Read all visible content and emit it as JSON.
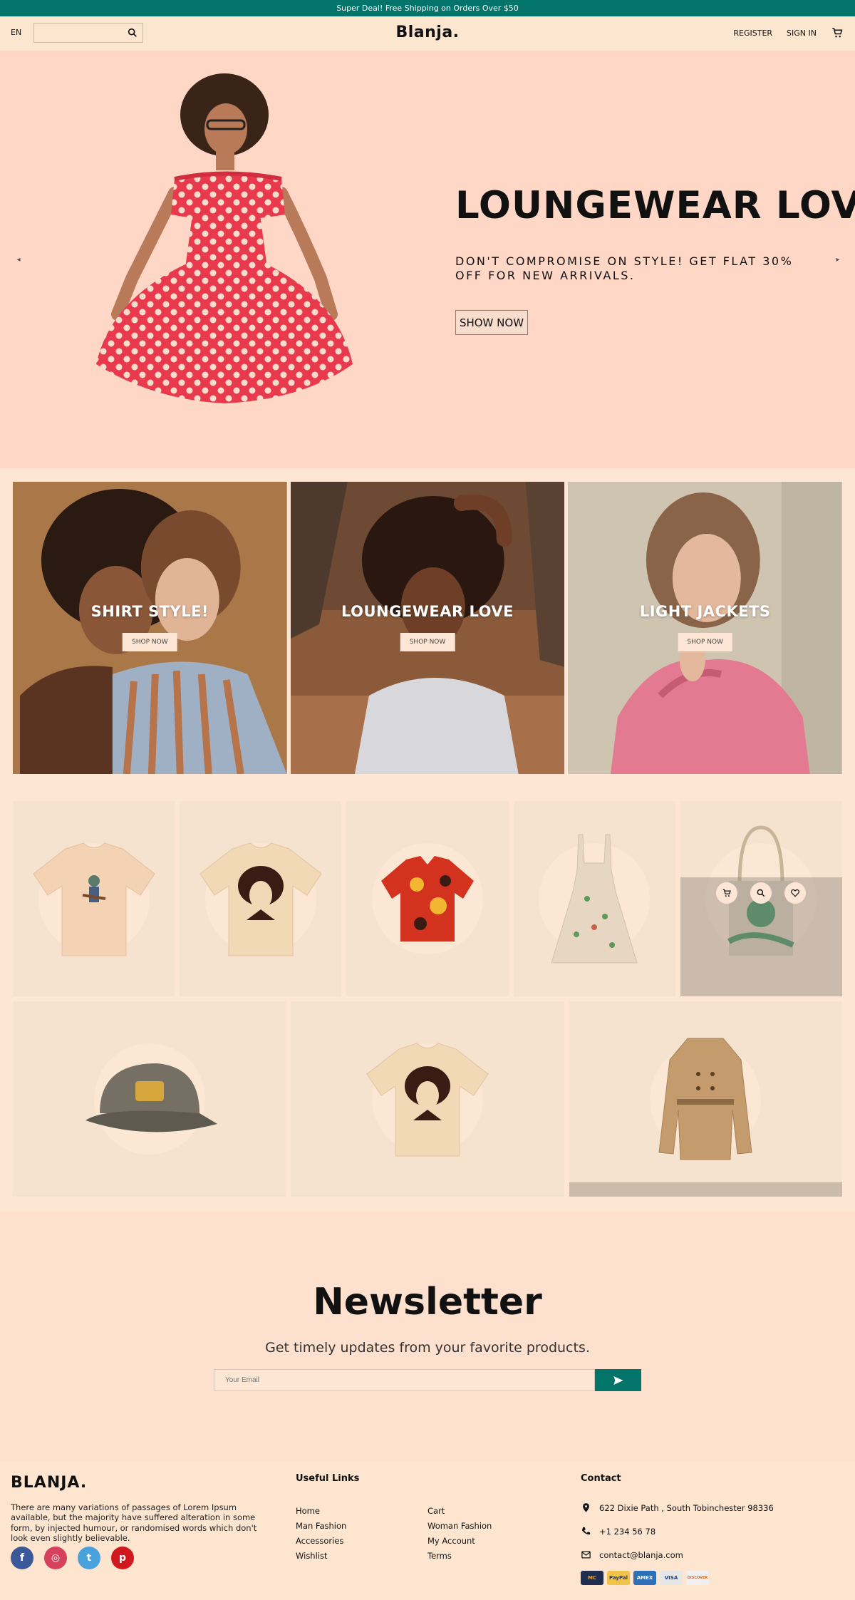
{
  "topbar": {
    "text": "Super Deal! Free Shipping on Orders Over $50"
  },
  "header": {
    "lang": "EN",
    "search_placeholder": "",
    "logo": "Blanja.",
    "register": "REGISTER",
    "signin": "SIGN IN"
  },
  "hero": {
    "title": "LOUNGEWEAR LOVE",
    "subtitle": "DON'T COMPROMISE ON STYLE! GET FLAT 30% OFF FOR NEW ARRIVALS.",
    "button": "SHOW NOW",
    "prev_arrow": "◂",
    "next_arrow": "▸"
  },
  "categories": [
    {
      "title": "SHIRT STYLE!",
      "button": "SHOP NOW"
    },
    {
      "title": "LOUNGEWEAR LOVE",
      "button": "SHOP NOW"
    },
    {
      "title": "LIGHT JACKETS",
      "button": "SHOP NOW"
    }
  ],
  "newsletter": {
    "title": "Newsletter",
    "subtitle": "Get timely updates from your favorite products.",
    "email_placeholder": "Your Email"
  },
  "footer": {
    "logo": "BLANJA.",
    "about": "There are many variations of passages of Lorem Ipsum available, but the majority have suffered alteration in some form, by injected humour, or randomised words which don't look even slightly believable.",
    "useful_links_title": "Useful Links",
    "links_col1": [
      "Home",
      "Man Fashion",
      "Accessories",
      "Wishlist"
    ],
    "links_col2": [
      "Cart",
      "Woman Fashion",
      "My Account",
      "Terms"
    ],
    "contact_title": "Contact",
    "address": "622 Dixie Path , South Tobinchester 98336",
    "phone": "+1 234 56 78",
    "email": "contact@blanja.com",
    "payments": [
      "MC",
      "PayPal",
      "AMEX",
      "VISA",
      "DISCOVER"
    ]
  },
  "colors": {
    "accent": "#037469",
    "hero_bg": "#fed7c6",
    "page_bg": "#fde6d4"
  }
}
